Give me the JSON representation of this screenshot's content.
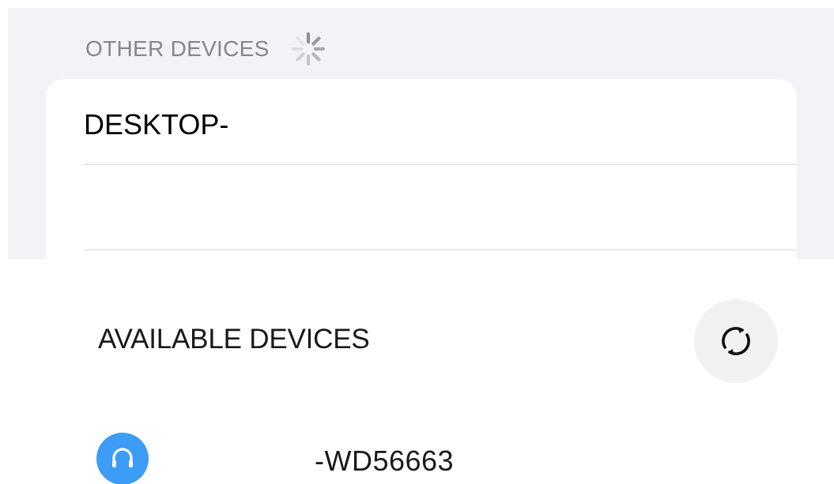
{
  "other_devices": {
    "header": "OTHER DEVICES",
    "spinner_icon": "loading-spinner-icon",
    "items": [
      {
        "label": "DESKTOP-"
      },
      {
        "label": ""
      }
    ]
  },
  "available_devices": {
    "header": "AVAILABLE DEVICES",
    "refresh_icon": "refresh-icon",
    "items": [
      {
        "name": "-WD56663",
        "icon": "headphones-icon"
      }
    ]
  },
  "colors": {
    "panel_background": "#f2f2f7",
    "section_header_text": "#86868b",
    "accent_blue": "#3d9cf5",
    "refresh_button_background": "#f1f1f1"
  }
}
